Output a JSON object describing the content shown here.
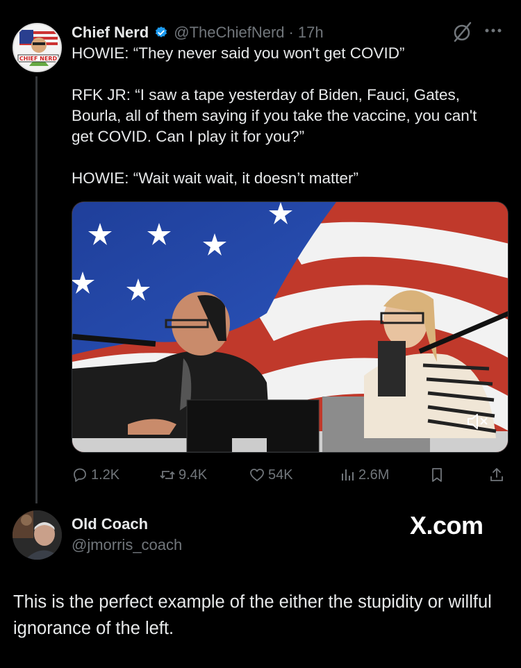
{
  "tweet": {
    "author_name": "Chief Nerd",
    "handle": "@TheChiefNerd",
    "separator": "·",
    "time": "17h",
    "avatar_label": "CHIEF NERD",
    "paragraphs": [
      "HOWIE: “They never said you won't get COVID”",
      "RFK JR: “I saw a tape yesterday of Biden, Fauci, Gates, Bourla, all of them saying if you take the vaccine, you can't get COVID. Can I play it for you?”",
      "HOWIE: “Wait wait wait, it doesn’t matter”"
    ],
    "stats": {
      "replies": "1.2K",
      "reposts": "9.4K",
      "likes": "54K",
      "views": "2.6M"
    }
  },
  "reply": {
    "author_name": "Old Coach",
    "handle": "@jmorris_coach",
    "watermark": "X.com",
    "text": "This is the perfect example of the either the stupidity or willful ignorance of the left."
  },
  "colors": {
    "background": "#000000",
    "text": "#e7e9ea",
    "muted": "#71767b",
    "verified": "#1d9bf0"
  },
  "icons": [
    "verified-badge-icon",
    "grok-icon",
    "more-icon",
    "reply-icon",
    "repost-icon",
    "like-icon",
    "views-icon",
    "bookmark-icon",
    "share-icon",
    "mute-icon"
  ]
}
